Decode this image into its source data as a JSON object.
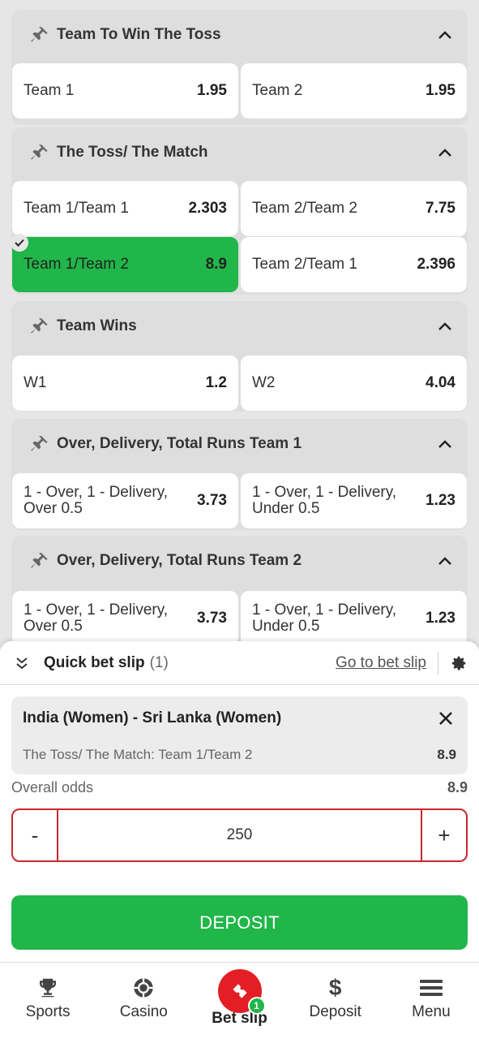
{
  "markets": [
    {
      "title": "Team To Win The Toss",
      "odds": [
        {
          "label": "Team 1",
          "value": "1.95"
        },
        {
          "label": "Team 2",
          "value": "1.95"
        }
      ]
    },
    {
      "title": "The Toss/ The Match",
      "odds": [
        {
          "label": "Team 1/Team 1",
          "value": "2.303"
        },
        {
          "label": "Team 2/Team 2",
          "value": "7.75"
        },
        {
          "label": "Team 1/Team 2",
          "value": "8.9"
        },
        {
          "label": "Team 2/Team 1",
          "value": "2.396"
        }
      ]
    },
    {
      "title": "Team Wins",
      "odds": [
        {
          "label": "W1",
          "value": "1.2"
        },
        {
          "label": "W2",
          "value": "4.04"
        }
      ]
    },
    {
      "title": "Over, Delivery, Total Runs Team 1",
      "odds": [
        {
          "label1": "1 - Over, 1 - Delivery,",
          "label2": "Over 0.5",
          "value": "3.73"
        },
        {
          "label1": "1 - Over, 1 - Delivery,",
          "label2": "Under 0.5",
          "value": "1.23"
        }
      ]
    },
    {
      "title": "Over, Delivery, Total Runs Team 2",
      "odds": [
        {
          "label1": "1 - Over, 1 - Delivery,",
          "label2": "Over 0.5",
          "value": "3.73"
        },
        {
          "label1": "1 - Over, 1 - Delivery,",
          "label2": "Under 0.5",
          "value": "1.23"
        }
      ]
    }
  ],
  "slip": {
    "title": "Quick bet slip",
    "count": "(1)",
    "goto_label": "Go to bet slip",
    "match": "India (Women) - Sri Lanka (Women)",
    "selection": "The Toss/ The Match: Team 1/Team 2",
    "selection_odds": "8.9",
    "overall_label": "Overall odds",
    "overall_value": "8.9",
    "minus": "-",
    "plus": "+",
    "stake": "250",
    "deposit_label": "DEPOSIT"
  },
  "nav": {
    "sports": "Sports",
    "casino": "Casino",
    "betslip": "Bet slip",
    "betslip_badge": "1",
    "deposit": "Deposit",
    "menu": "Menu"
  },
  "colors": {
    "accent_green": "#21b64a",
    "accent_red": "#e31e24",
    "stake_border": "#c8282d"
  }
}
